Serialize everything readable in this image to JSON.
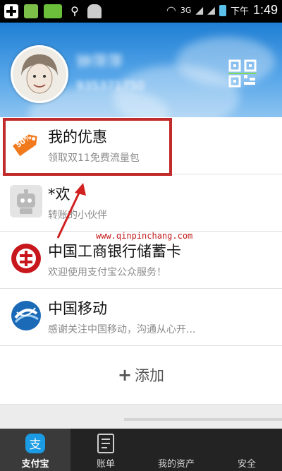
{
  "status_bar": {
    "network": "3G",
    "time_prefix": "下午",
    "time": "1:49"
  },
  "header": {
    "name": "钟萍萍",
    "id": "935371750"
  },
  "list": [
    {
      "title": "我的优惠",
      "subtitle": "领取双11免费流量包",
      "icon": "discount-tag-icon",
      "badge": "50%"
    },
    {
      "title": "*欢",
      "subtitle": "转账的小伙伴",
      "icon": "robot-icon"
    },
    {
      "title": "中国工商银行储蓄卡",
      "subtitle": "欢迎使用支付宝公众服务！",
      "icon": "icbc-logo-icon"
    },
    {
      "title": "中国移动",
      "subtitle": "感谢关注中国移动，沟通从心开...",
      "icon": "china-mobile-logo-icon"
    }
  ],
  "add": {
    "label": "添加"
  },
  "watermark": "www.qinpinchang.com",
  "tabs": [
    {
      "label": "支付宝",
      "icon": "alipay-icon",
      "active": true
    },
    {
      "label": "账单",
      "icon": "bill-icon",
      "active": false
    },
    {
      "label": "我的资产",
      "icon": "assets-icon",
      "active": false
    },
    {
      "label": "安全",
      "icon": "security-icon",
      "active": false
    }
  ],
  "colors": {
    "header": "#1f7fd4",
    "highlight": "#c22b2b",
    "tabbar": "#232323"
  }
}
